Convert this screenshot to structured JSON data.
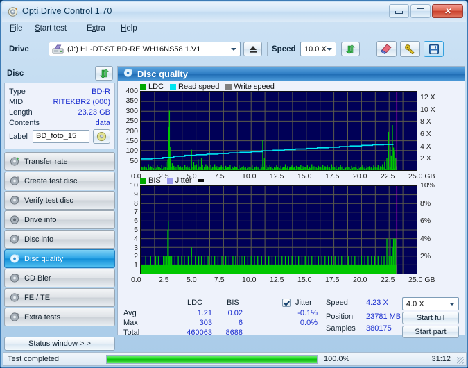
{
  "window": {
    "title": "Opti Drive Control 1.70",
    "icon": "disc-icon",
    "minimize": "minimize-icon",
    "maximize": "maximize-icon",
    "close": "close-icon"
  },
  "menu": [
    {
      "label": "File",
      "accel": "F"
    },
    {
      "label": "Start test",
      "accel": "S"
    },
    {
      "label": "Extra",
      "accel": "x"
    },
    {
      "label": "Help",
      "accel": "H"
    }
  ],
  "toolbar": {
    "drive_label": "Drive",
    "drive_value": "(J:)  HL-DT-ST BD-RE  WH16NS58 1.V1",
    "drive_icon": "drive-icon",
    "eject_icon": "eject-icon",
    "speed_label": "Speed",
    "speed_value": "10.0 X",
    "refresh_icon": "refresh-icon",
    "erase_icon": "eraser-icon",
    "tools_icon": "wrench-icon",
    "save_icon": "save-icon"
  },
  "disc": {
    "header": "Disc",
    "refresh_icon": "refresh-icon",
    "rows": [
      {
        "key": "Type",
        "value": "BD-R"
      },
      {
        "key": "MID",
        "value": "RITEKBR2 (000)"
      },
      {
        "key": "Length",
        "value": "23.23 GB"
      },
      {
        "key": "Contents",
        "value": "data"
      }
    ],
    "label_key": "Label",
    "label_value": "BD_foto_15",
    "label_icon": "disc-icon"
  },
  "tabs": [
    {
      "label": "Transfer rate",
      "icon": "transfer-rate-icon",
      "selected": false
    },
    {
      "label": "Create test disc",
      "icon": "create-disc-icon",
      "selected": false
    },
    {
      "label": "Verify test disc",
      "icon": "verify-disc-icon",
      "selected": false
    },
    {
      "label": "Drive info",
      "icon": "drive-info-icon",
      "selected": false
    },
    {
      "label": "Disc info",
      "icon": "disc-info-icon",
      "selected": false
    },
    {
      "label": "Disc quality",
      "icon": "disc-quality-icon",
      "selected": true
    },
    {
      "label": "CD Bler",
      "icon": "cd-bler-icon",
      "selected": false
    },
    {
      "label": "FE / TE",
      "icon": "fe-te-icon",
      "selected": false
    },
    {
      "label": "Extra tests",
      "icon": "extra-tests-icon",
      "selected": false
    }
  ],
  "status_window_button": "Status window > >",
  "main": {
    "title": "Disc quality",
    "title_icon": "disc-quality-icon"
  },
  "stats": {
    "col_ldc": "LDC",
    "col_bis": "BIS",
    "jitter_label": "Jitter",
    "jitter_checked": true,
    "row_avg": "Avg",
    "row_max": "Max",
    "row_total": "Total",
    "avg_ldc": "1.21",
    "avg_bis": "0.02",
    "avg_jitter": "-0.1%",
    "max_ldc": "303",
    "max_bis": "6",
    "max_jitter": "0.0%",
    "total_ldc": "460063",
    "total_bis": "8688",
    "speed_label": "Speed",
    "speed_value": "4.23 X",
    "position_label": "Position",
    "position_value": "23781 MB",
    "samples_label": "Samples",
    "samples_value": "380175",
    "speed_select": "4.0 X",
    "start_full": "Start full",
    "start_part": "Start part"
  },
  "statusbar": {
    "message": "Test completed",
    "percent": "100.0%",
    "percent_value": 100,
    "elapsed": "31:12"
  },
  "chart_data": [
    {
      "type": "line",
      "name": "disc-quality-ldc-chart",
      "title": "",
      "xlabel": "GB",
      "ylabel": "",
      "xlim": [
        0,
        25
      ],
      "xticks": [
        "0.0",
        "2.5",
        "5.0",
        "7.5",
        "10.0",
        "12.5",
        "15.0",
        "17.5",
        "20.0",
        "22.5",
        "25.0 GB"
      ],
      "ylim": [
        0,
        400
      ],
      "yticks": [
        50,
        100,
        150,
        200,
        250,
        300,
        350,
        400
      ],
      "y2lim": [
        0,
        13
      ],
      "y2ticks": [
        "2 X",
        "4 X",
        "6 X",
        "8 X",
        "10 X",
        "12 X"
      ],
      "grid": true,
      "legend": [
        {
          "label": "LDC",
          "color": "#00a800"
        },
        {
          "label": "Read speed",
          "color": "#00e6f0"
        },
        {
          "label": "Write speed",
          "color": "#808080"
        }
      ],
      "series": [
        {
          "name": "LDC",
          "color": "#00c800",
          "type": "impulse",
          "x": [
            0.1,
            0.3,
            0.5,
            0.7,
            0.9,
            1.1,
            1.3,
            1.5,
            1.7,
            1.9,
            2.1,
            2.3,
            2.45,
            2.55,
            2.6,
            2.65,
            2.7,
            2.85,
            3.0,
            3.2,
            3.4,
            3.6,
            3.8,
            4.0,
            4.2,
            4.4,
            4.6,
            4.8,
            4.9,
            5.05,
            5.2,
            5.35,
            5.5,
            5.6,
            5.75,
            5.9,
            6.05,
            6.2,
            6.35,
            6.5,
            6.7,
            6.9,
            7.1,
            7.3,
            7.5,
            7.7,
            7.9,
            8.1,
            8.3,
            8.5,
            8.7,
            8.9,
            9.1,
            9.3,
            9.5,
            9.7,
            9.9,
            10.1,
            10.3,
            10.5,
            10.7,
            10.9,
            11.05,
            11.2,
            11.35,
            11.5,
            11.7,
            11.9,
            12.1,
            12.3,
            12.5,
            12.7,
            12.9,
            13.1,
            13.3,
            13.5,
            13.7,
            13.9,
            14.1,
            14.3,
            14.5,
            14.7,
            14.9,
            15.1,
            15.3,
            15.5,
            15.7,
            15.9,
            16.1,
            16.3,
            16.5,
            16.7,
            16.9,
            17.1,
            17.3,
            17.5,
            17.7,
            17.9,
            18.1,
            18.3,
            18.5,
            18.7,
            18.9,
            19.1,
            19.3,
            19.5,
            19.7,
            19.9,
            20.1,
            20.3,
            20.5,
            20.7,
            20.9,
            21.1,
            21.3,
            21.5,
            21.7,
            21.9,
            22.1,
            22.3,
            22.45,
            22.6,
            22.7,
            22.8,
            22.9,
            23.0,
            23.1,
            23.15
          ],
          "y": [
            18,
            22,
            16,
            30,
            20,
            26,
            18,
            24,
            16,
            28,
            22,
            40,
            55,
            220,
            303,
            120,
            60,
            35,
            22,
            18,
            26,
            20,
            16,
            28,
            22,
            18,
            104,
            40,
            24,
            30,
            56,
            20,
            62,
            26,
            18,
            30,
            22,
            16,
            26,
            18,
            30,
            20,
            16,
            24,
            18,
            22,
            16,
            26,
            18,
            20,
            16,
            24,
            18,
            22,
            16,
            20,
            18,
            24,
            16,
            22,
            18,
            30,
            155,
            60,
            24,
            18,
            26,
            20,
            16,
            24,
            18,
            22,
            16,
            30,
            20,
            18,
            24,
            16,
            22,
            18,
            26,
            20,
            16,
            24,
            18,
            30,
            20,
            16,
            22,
            18,
            26,
            20,
            24,
            16,
            30,
            18,
            22,
            16,
            26,
            20,
            18,
            24,
            16,
            22,
            18,
            30,
            20,
            16,
            26,
            18,
            22,
            20,
            16,
            24,
            18,
            26,
            20,
            30,
            44,
            60,
            195,
            120,
            75,
            230,
            115,
            95,
            60,
            20
          ]
        },
        {
          "name": "Read speed",
          "color": "#00e6f0",
          "type": "step-line",
          "x": [
            0,
            1.0,
            2.0,
            3.0,
            4.0,
            5.0,
            6.0,
            7.0,
            8.0,
            9.0,
            10.0,
            11.0,
            12.0,
            13.0,
            14.0,
            15.0,
            16.0,
            17.0,
            18.0,
            19.0,
            20.0,
            21.0,
            22.0,
            22.9
          ],
          "y2": [
            1.85,
            1.95,
            2.1,
            2.3,
            2.45,
            2.55,
            2.65,
            2.75,
            2.85,
            2.95,
            3.05,
            3.2,
            3.3,
            3.4,
            3.5,
            3.6,
            3.7,
            3.8,
            3.9,
            4.0,
            4.1,
            4.2,
            4.25,
            4.25
          ]
        }
      ],
      "marker_line": {
        "x": 23.2,
        "color": "#d400d4"
      }
    },
    {
      "type": "bar",
      "name": "disc-quality-bis-chart",
      "title": "",
      "xlabel": "GB",
      "xlim": [
        0,
        25
      ],
      "xticks": [
        "0.0",
        "2.5",
        "5.0",
        "7.5",
        "10.0",
        "12.5",
        "15.0",
        "17.5",
        "20.0",
        "22.5",
        "25.0 GB"
      ],
      "ylim": [
        0,
        10
      ],
      "yticks": [
        1,
        2,
        3,
        4,
        5,
        6,
        7,
        8,
        9,
        10
      ],
      "y2lim": [
        0,
        10
      ],
      "y2ticks": [
        "2%",
        "4%",
        "6%",
        "8%",
        "10%"
      ],
      "grid": true,
      "legend": [
        {
          "label": "BIS",
          "color": "#00a800"
        },
        {
          "label": "Jitter",
          "color": "#9a9aee"
        }
      ],
      "series": [
        {
          "name": "BIS",
          "color": "#00c800",
          "type": "impulse",
          "baseline": 1,
          "x": [
            0.45,
            0.9,
            1.35,
            1.6,
            2.05,
            2.2,
            2.35,
            2.45,
            2.5,
            2.55,
            2.6,
            2.65,
            2.8,
            3.1,
            3.4,
            3.7,
            3.95,
            4.3,
            4.6,
            4.95,
            5.25,
            5.5,
            5.8,
            6.1,
            6.4,
            6.7,
            7.0,
            7.35,
            7.7,
            8.0,
            8.35,
            8.6,
            8.9,
            9.1,
            9.25,
            9.4,
            9.7,
            10.0,
            10.3,
            10.6,
            10.95,
            11.3,
            11.6,
            11.9,
            12.2,
            12.5,
            12.8,
            13.1,
            13.4,
            13.7,
            14.0,
            14.3,
            14.6,
            14.9,
            15.2,
            15.5,
            15.8,
            16.1,
            16.4,
            16.7,
            17.0,
            17.3,
            17.6,
            17.9,
            18.2,
            18.5,
            18.8,
            19.1,
            19.4,
            19.7,
            20.0,
            20.3,
            20.6,
            20.9,
            21.2,
            21.5,
            21.8,
            22.05,
            22.3,
            22.5,
            22.6,
            22.7,
            22.8,
            22.9,
            23.0,
            23.1
          ],
          "y": [
            2,
            2,
            2,
            2,
            2,
            2,
            2,
            5,
            6,
            2,
            2,
            2,
            2,
            2,
            2,
            2,
            2,
            2,
            3,
            2,
            2,
            2,
            2,
            2,
            2,
            2,
            2,
            2,
            2,
            2,
            2,
            2,
            2,
            2,
            2,
            2,
            2,
            2,
            2,
            2,
            2,
            2,
            2,
            2,
            2,
            2,
            2,
            2,
            2,
            2,
            2,
            2,
            2,
            2,
            2,
            2,
            2,
            2,
            2,
            2,
            2,
            2,
            2,
            2,
            2,
            2,
            2,
            2,
            2,
            2,
            2,
            2,
            2,
            2,
            2,
            2,
            2,
            2,
            4,
            2,
            4,
            2,
            3,
            4,
            4,
            4
          ]
        }
      ],
      "marker_line": {
        "x": 23.2,
        "color": "#d400d4"
      }
    }
  ]
}
